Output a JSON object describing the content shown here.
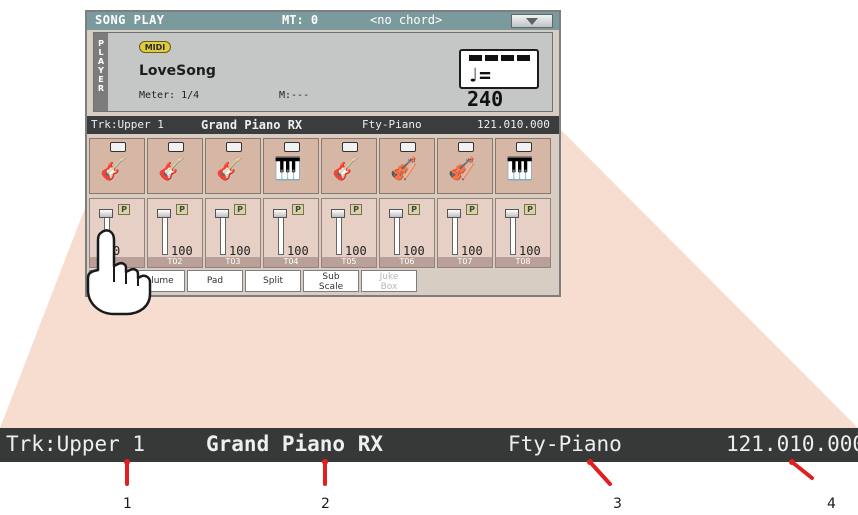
{
  "colors": {
    "titlebar": "#7b9a9d",
    "wedge": "#f7ddd0",
    "callout": "#e02020",
    "zoom_bar_bg": "#373939"
  },
  "screen": {
    "title": "SONG PLAY",
    "mt": "MT: 0",
    "chord": "<no chord>",
    "menu_icon": "chevron-down-icon",
    "player": {
      "tab": "PLAYER",
      "midi_badge": "MIDI",
      "song": "LoveSong",
      "meter": "Meter: 1/4",
      "measure": "M:---",
      "tempo": "♩= 240"
    },
    "track_info": {
      "track": "Trk:Upper 1",
      "sound": "Grand Piano RX",
      "family": "Fty-Piano",
      "bank": "121.010.000"
    },
    "instruments": [
      {
        "icon": "guitar-icon",
        "glyph": "🎸"
      },
      {
        "icon": "guitar-icon",
        "glyph": "🎸"
      },
      {
        "icon": "guitar-icon",
        "glyph": "🎸"
      },
      {
        "icon": "piano-keys-icon",
        "glyph": "🎹"
      },
      {
        "icon": "guitar-icon",
        "glyph": "🎸"
      },
      {
        "icon": "strings-icon",
        "glyph": "🎻"
      },
      {
        "icon": "violin-icon",
        "glyph": "🎻"
      },
      {
        "icon": "keyboard-icon",
        "glyph": "🎹"
      }
    ],
    "mixer": [
      {
        "p": "P",
        "volume": "0",
        "label": ""
      },
      {
        "p": "P",
        "volume": "100",
        "label": "T02"
      },
      {
        "p": "P",
        "volume": "100",
        "label": "T03"
      },
      {
        "p": "P",
        "volume": "100",
        "label": "T04"
      },
      {
        "p": "P",
        "volume": "100",
        "label": "T05"
      },
      {
        "p": "P",
        "volume": "100",
        "label": "T06"
      },
      {
        "p": "P",
        "volume": "100",
        "label": "T07"
      },
      {
        "p": "P",
        "volume": "100",
        "label": "T08"
      }
    ],
    "tabs": [
      {
        "label": "",
        "dim": false
      },
      {
        "label": "Volume",
        "dim": false
      },
      {
        "label": "Pad",
        "dim": false
      },
      {
        "label": "Split",
        "dim": false
      },
      {
        "label": "Sub Scale",
        "dim": false
      },
      {
        "label": "Juke Box",
        "dim": true
      }
    ]
  },
  "zoom": {
    "track": "Trk:Upper 1",
    "sound": "Grand Piano RX",
    "family": "Fty-Piano",
    "bank": "121.010.000"
  },
  "callouts": [
    "1",
    "2",
    "3",
    "4"
  ]
}
